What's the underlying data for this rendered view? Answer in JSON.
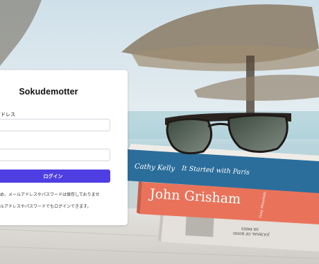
{
  "login": {
    "title": "Sokudemotter",
    "email_label": "アドレス",
    "email_value": "",
    "password_label": "ド",
    "password_value": "",
    "submit_label": "ログイン",
    "note_1": "ため、メールアドレスやパスワードは保存しておりませ",
    "note_2": "ールアドレスやパスワードでもログインできます。"
  },
  "background": {
    "book_top": {
      "line_1": "Cathy Kelly",
      "line_2": "It Started with Paris"
    },
    "book_middle": {
      "author": "John Grisham",
      "side_text": "Gray Mountain"
    },
    "book_bottom": {
      "line_1": "JOURNAL OF BOND",
      "line_2": "DE PARIS"
    }
  },
  "colors": {
    "accent": "#4f3fe3",
    "card_bg": "#ffffff",
    "book_top": "#2b6e9b",
    "book_middle": "#e9735a",
    "book_bottom": "#e4e0db"
  }
}
